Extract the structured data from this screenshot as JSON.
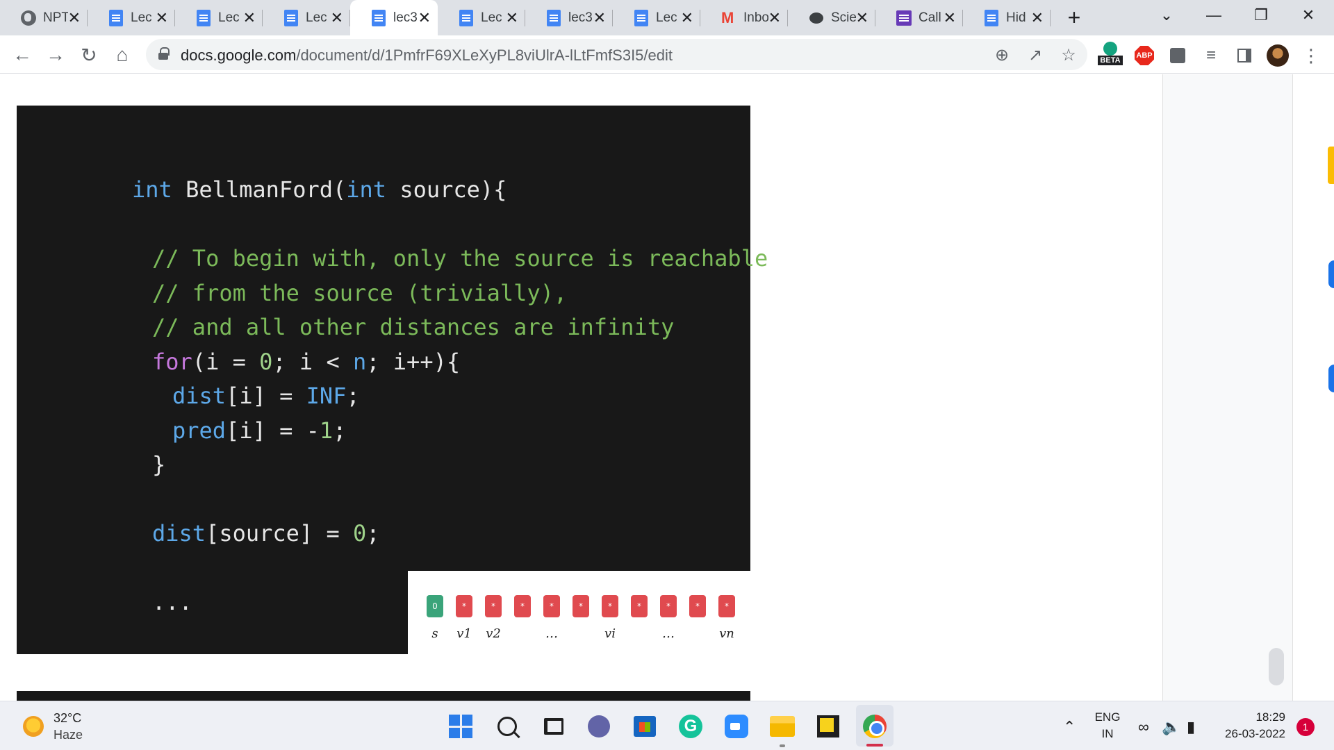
{
  "tabs": [
    {
      "label": "NPTEL",
      "icon": "globe-icon",
      "active": false
    },
    {
      "label": "Lec",
      "icon": "docs-icon",
      "active": false
    },
    {
      "label": "Lec",
      "icon": "docs-icon",
      "active": false
    },
    {
      "label": "Lec",
      "icon": "docs-icon",
      "active": false
    },
    {
      "label": "lec3",
      "icon": "docs-icon",
      "active": true
    },
    {
      "label": "Lec",
      "icon": "docs-icon",
      "active": false
    },
    {
      "label": "lec3",
      "icon": "docs-icon",
      "active": false
    },
    {
      "label": "Lec",
      "icon": "docs-icon",
      "active": false
    },
    {
      "label": "Inbox",
      "icon": "gmail-icon",
      "active": false
    },
    {
      "label": "Scie",
      "icon": "chat-icon",
      "active": false
    },
    {
      "label": "Call",
      "icon": "forms-icon",
      "active": false
    },
    {
      "label": "Hid",
      "icon": "docs-icon",
      "active": false
    }
  ],
  "toolbar": {
    "url_host": "docs.google.com",
    "url_path": "/document/d/1PmfrF69XLeXyPL8viUlrA-lLtFmfS3I5/edit",
    "beta_label": "BETA",
    "abp_label": "ABP"
  },
  "slide": {
    "code_lines": [
      {
        "indent": 0,
        "tokens": [
          {
            "t": "int",
            "c": "kw"
          },
          {
            "t": " BellmanFord(",
            "c": "wh"
          },
          {
            "t": "int",
            "c": "kw"
          },
          {
            "t": " source){",
            "c": "wh"
          }
        ]
      },
      {
        "indent": 0,
        "tokens": []
      },
      {
        "indent": 1,
        "tokens": [
          {
            "t": "// To begin with, only the source is reachable",
            "c": "cm"
          }
        ]
      },
      {
        "indent": 1,
        "tokens": [
          {
            "t": "// from the source (trivially),",
            "c": "cm"
          }
        ]
      },
      {
        "indent": 1,
        "tokens": [
          {
            "t": "// and all other distances are infinity",
            "c": "cm"
          }
        ]
      },
      {
        "indent": 1,
        "tokens": [
          {
            "t": "for",
            "c": "pk"
          },
          {
            "t": "(i = ",
            "c": "wh"
          },
          {
            "t": "0",
            "c": "num"
          },
          {
            "t": "; i < ",
            "c": "wh"
          },
          {
            "t": "n",
            "c": "kw"
          },
          {
            "t": "; i++){",
            "c": "wh"
          }
        ]
      },
      {
        "indent": 2,
        "tokens": [
          {
            "t": "dist",
            "c": "kw"
          },
          {
            "t": "[i] = ",
            "c": "wh"
          },
          {
            "t": "INF",
            "c": "kw"
          },
          {
            "t": ";",
            "c": "wh"
          }
        ]
      },
      {
        "indent": 2,
        "tokens": [
          {
            "t": "pred",
            "c": "kw"
          },
          {
            "t": "[i] = -",
            "c": "wh"
          },
          {
            "t": "1",
            "c": "num"
          },
          {
            "t": ";",
            "c": "wh"
          }
        ]
      },
      {
        "indent": 1,
        "tokens": [
          {
            "t": "}",
            "c": "wh"
          }
        ]
      },
      {
        "indent": 0,
        "tokens": []
      },
      {
        "indent": 1,
        "tokens": [
          {
            "t": "dist",
            "c": "kw"
          },
          {
            "t": "[source] = ",
            "c": "wh"
          },
          {
            "t": "0",
            "c": "num"
          },
          {
            "t": ";",
            "c": "wh"
          }
        ]
      },
      {
        "indent": 0,
        "tokens": []
      },
      {
        "indent": 1,
        "tokens": [
          {
            "t": "...",
            "c": "wh"
          }
        ]
      }
    ],
    "array": {
      "cells": [
        "0",
        "*",
        "*",
        "*",
        "*",
        "*",
        "*",
        "*",
        "*",
        "*",
        "*"
      ],
      "labels": [
        "s",
        "v1",
        "v2",
        "…",
        "vi",
        "…",
        "vn"
      ]
    }
  },
  "taskbar": {
    "temperature": "32°C",
    "condition": "Haze",
    "lang_top": "ENG",
    "lang_bottom": "IN",
    "time": "18:29",
    "date": "26-03-2022",
    "notification_count": "1"
  }
}
